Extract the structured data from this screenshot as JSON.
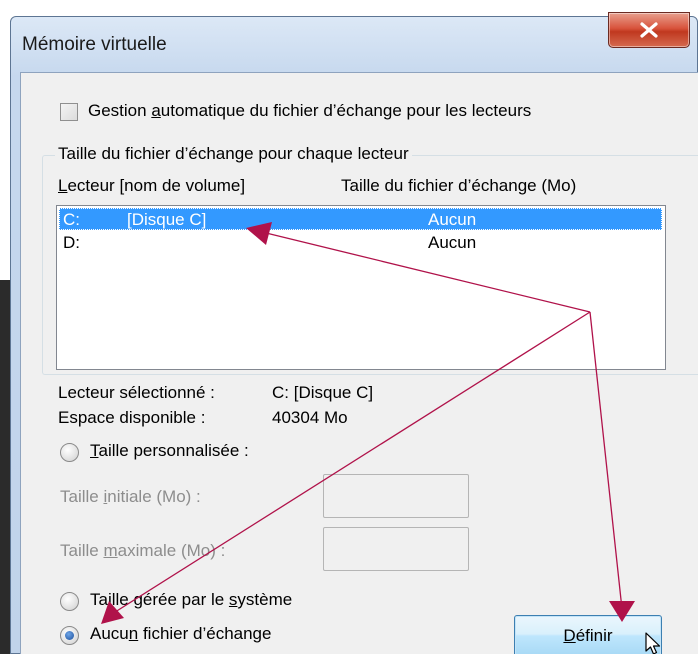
{
  "window": {
    "title": "Mémoire virtuelle",
    "close_icon": "close-icon"
  },
  "auto_manage": {
    "label_before": "Gestion ",
    "label_accel": "a",
    "label_after": "utomatique du fichier d’échange pour les lecteurs",
    "checked": false
  },
  "group": {
    "title": "Taille du fichier d’échange pour chaque lecteur",
    "col_drive_accel": "L",
    "col_drive_rest": "ecteur [nom de volume]",
    "col_size": "Taille du fichier d’échange (Mo)"
  },
  "drives": [
    {
      "letter": "C:",
      "volume": "[Disque C]",
      "size": "Aucun",
      "selected": true
    },
    {
      "letter": "D:",
      "volume": "",
      "size": "Aucun",
      "selected": false
    }
  ],
  "selected_info": {
    "drive_label": "Lecteur sélectionné :",
    "drive_value": "C:  [Disque C]",
    "space_label": "Espace disponible :",
    "space_value": "40304 Mo"
  },
  "options": {
    "custom_accel": "T",
    "custom_rest": "aille personnalisée :",
    "initial_before": "Taille ",
    "initial_accel": "i",
    "initial_after": "nitiale (Mo) :",
    "max_before": "Taille ",
    "max_accel": "m",
    "max_after": "aximale (Mo) :",
    "initial_value": "",
    "max_value": "",
    "system_before": "Taille gérée par le ",
    "system_accel": "s",
    "system_after": "ystème",
    "none_before": "Aucu",
    "none_accel": "n",
    "none_after": " fichier d’échange",
    "selected_option": "none"
  },
  "buttons": {
    "define_accel": "D",
    "define_rest": "éfinir"
  },
  "annotation": {
    "color": "#b0124a"
  }
}
